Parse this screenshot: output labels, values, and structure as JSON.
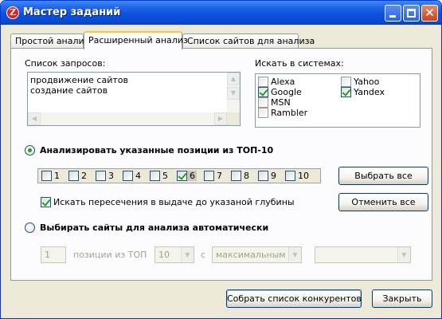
{
  "window": {
    "title": "Мастер заданий",
    "app_icon_glyph": "Z"
  },
  "tabs": [
    "Простой анализ",
    "Расширенный анализ",
    "Список сайтов для анализа"
  ],
  "queries": {
    "label": "Список запросов:",
    "items": [
      "продвижение сайтов",
      "создание сайтов"
    ]
  },
  "engines": {
    "label": "Искать в системах:",
    "items": [
      {
        "name": "Alexa",
        "checked": false
      },
      {
        "name": "Google",
        "checked": true
      },
      {
        "name": "MSN",
        "checked": false
      },
      {
        "name": "Rambler",
        "checked": false
      },
      {
        "name": "Yahoo",
        "checked": false
      },
      {
        "name": "Yandex",
        "checked": true
      }
    ]
  },
  "mode_positions": {
    "label": "Анализировать указанные позиции из ТОП-10",
    "selected": true,
    "positions": [
      {
        "n": "1",
        "checked": false
      },
      {
        "n": "2",
        "checked": false
      },
      {
        "n": "3",
        "checked": false
      },
      {
        "n": "4",
        "checked": false
      },
      {
        "n": "5",
        "checked": false
      },
      {
        "n": "6",
        "checked": true
      },
      {
        "n": "7",
        "checked": false
      },
      {
        "n": "8",
        "checked": false
      },
      {
        "n": "9",
        "checked": false
      },
      {
        "n": "10",
        "checked": false
      }
    ],
    "select_all": "Выбрать все",
    "cancel_all": "Отменить все",
    "intersect_label": "Искать пересечения в выдаче до указаной глубины",
    "intersect_checked": true
  },
  "mode_auto": {
    "label": "Выбирать сайты для анализа автоматически",
    "selected": false,
    "count_value": "1",
    "positions_label": "позиции из ТОП",
    "top_value": "10",
    "with_label": "с",
    "level_value": "максимальным",
    "extra_value": ""
  },
  "footer": {
    "collect_button": "Собрать список конкурентов",
    "close_button": "Закрыть"
  },
  "colors": {
    "title_bar": "#0a52e0",
    "check": "#21a121",
    "tab_highlight": "#ffc83c",
    "window_bg": "#ece9d8"
  }
}
